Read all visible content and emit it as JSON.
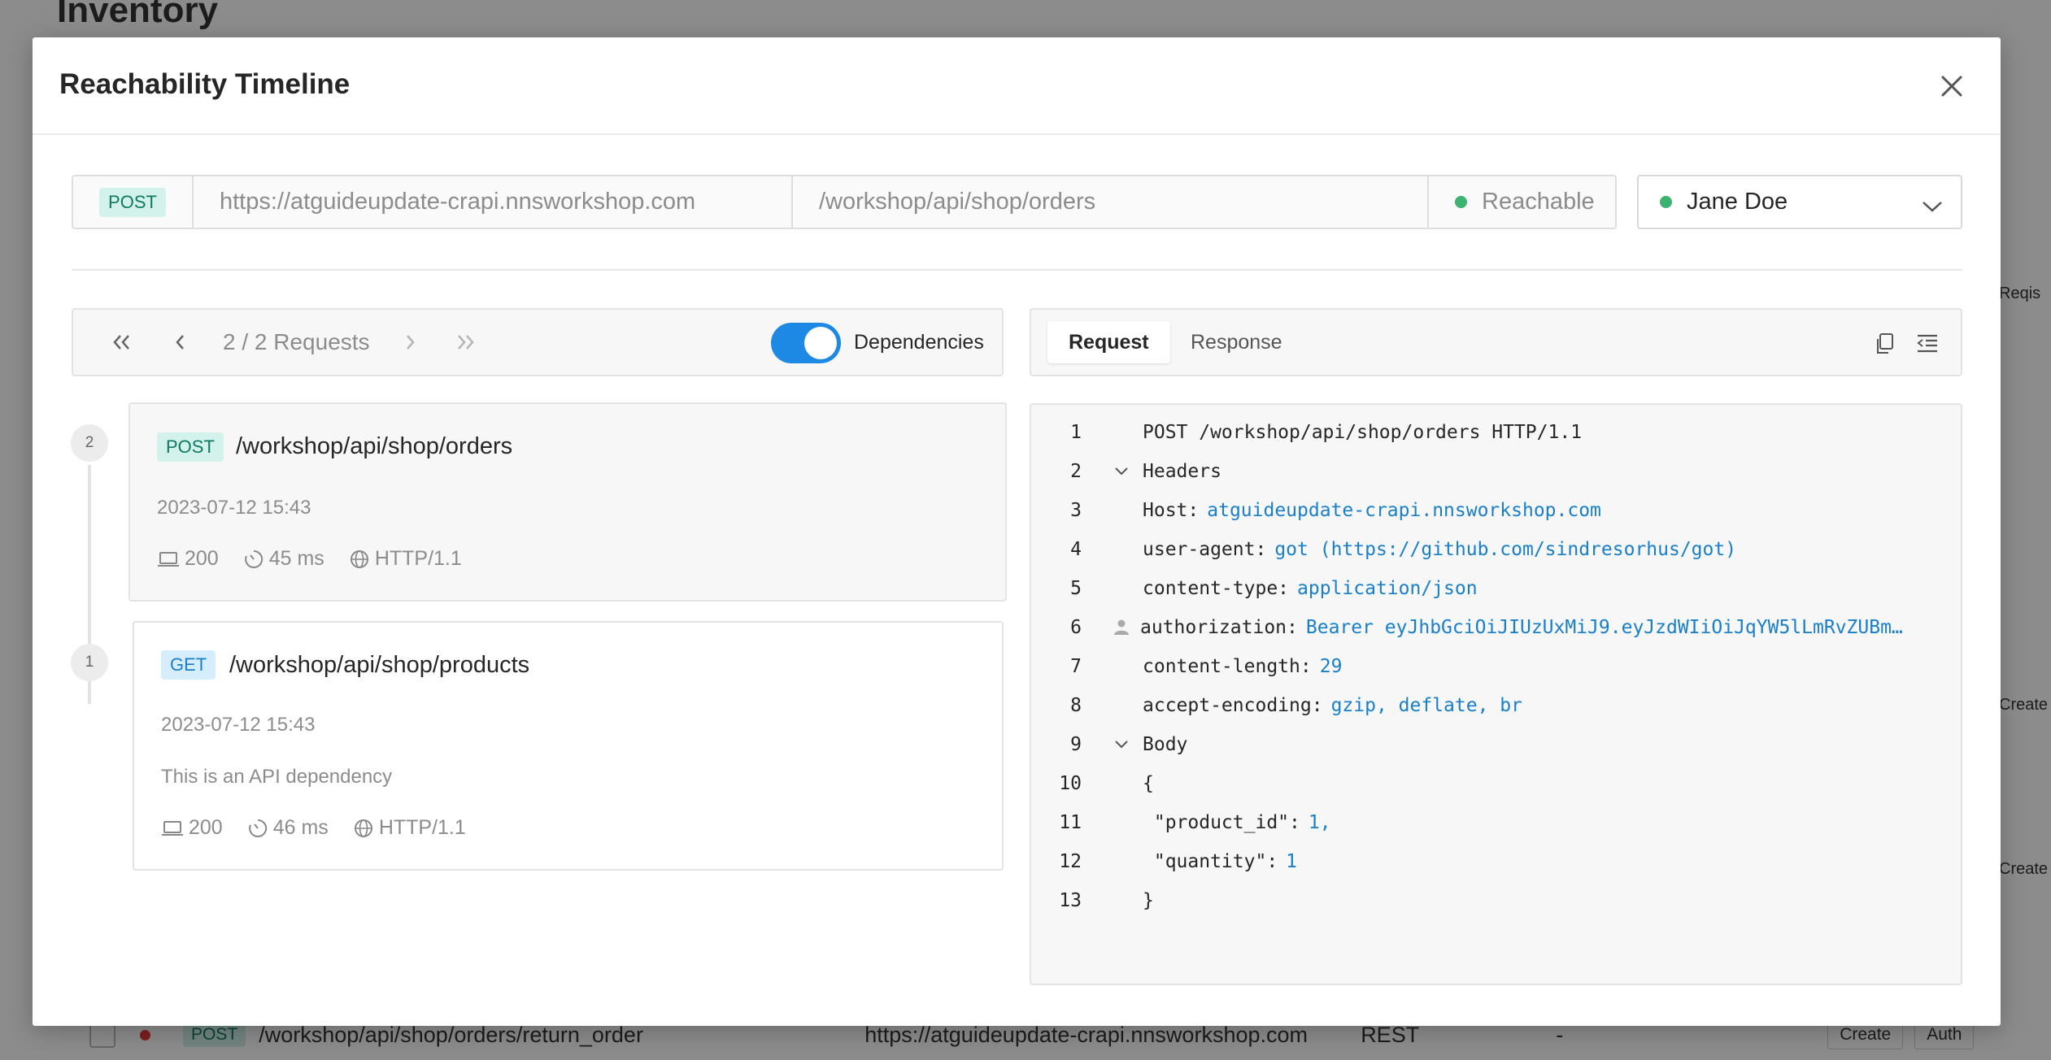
{
  "background": {
    "page_title": "Inventory",
    "right_col_labels": [
      "Reqis",
      "Create",
      "Create"
    ],
    "row": {
      "method": "POST",
      "path": "/workshop/api/shop/orders/return_order",
      "host": "https://atguideupdate-crapi.nnsworkshop.com",
      "type": "REST",
      "dash": "-",
      "create_label": "Create",
      "auth_label": "Auth",
      "status_color": "#e53935"
    }
  },
  "modal": {
    "title": "Reachability Timeline",
    "close_icon": "close-icon"
  },
  "url_bar": {
    "method": "POST",
    "host": "https://atguideupdate-crapi.nnsworkshop.com",
    "path": "/workshop/api/shop/orders",
    "status": "Reachable",
    "status_color": "#3cb371"
  },
  "user_select": {
    "name": "Jane Doe",
    "status_color": "#3cb371"
  },
  "pager": {
    "count": "2 / 2 Requests",
    "dependencies_label": "Dependencies",
    "dependencies_on": true,
    "toggle_color": "#1e88e5"
  },
  "requests": [
    {
      "index": "2",
      "method": "POST",
      "path": "/workshop/api/shop/orders",
      "date": "2023-07-12 15:43",
      "note": "",
      "status": "200",
      "duration": "45 ms",
      "protocol": "HTTP/1.1"
    },
    {
      "index": "1",
      "method": "GET",
      "path": "/workshop/api/shop/products",
      "date": "2023-07-12 15:43",
      "note": "This is an API dependency",
      "status": "200",
      "duration": "46 ms",
      "protocol": "HTTP/1.1"
    }
  ],
  "detail_tabs": {
    "request_label": "Request",
    "response_label": "Response",
    "active": "Request"
  },
  "code": {
    "lines": [
      {
        "n": "1",
        "key": "POST /workshop/api/shop/orders HTTP/1.1",
        "value": ""
      },
      {
        "n": "2",
        "key": "Headers",
        "value": ""
      },
      {
        "n": "3",
        "key": "Host:",
        "value": "atguideupdate-crapi.nnsworkshop.com"
      },
      {
        "n": "4",
        "key": "user-agent:",
        "value": "got (https://github.com/sindresorhus/got)"
      },
      {
        "n": "5",
        "key": "content-type:",
        "value": "application/json"
      },
      {
        "n": "6",
        "key": "authorization:",
        "value": "Bearer eyJhbGciOiJIUzUxMiJ9.eyJzdWIiOiJqYW5lLmRvZUBm…"
      },
      {
        "n": "7",
        "key": "content-length:",
        "value": "29"
      },
      {
        "n": "8",
        "key": "accept-encoding:",
        "value": "gzip, deflate, br"
      },
      {
        "n": "9",
        "key": "Body",
        "value": ""
      },
      {
        "n": "10",
        "key": "{",
        "value": ""
      },
      {
        "n": "11",
        "key": " \"product_id\":",
        "value": "1,"
      },
      {
        "n": "12",
        "key": " \"quantity\":",
        "value": "1"
      },
      {
        "n": "13",
        "key": "}",
        "value": ""
      }
    ]
  }
}
